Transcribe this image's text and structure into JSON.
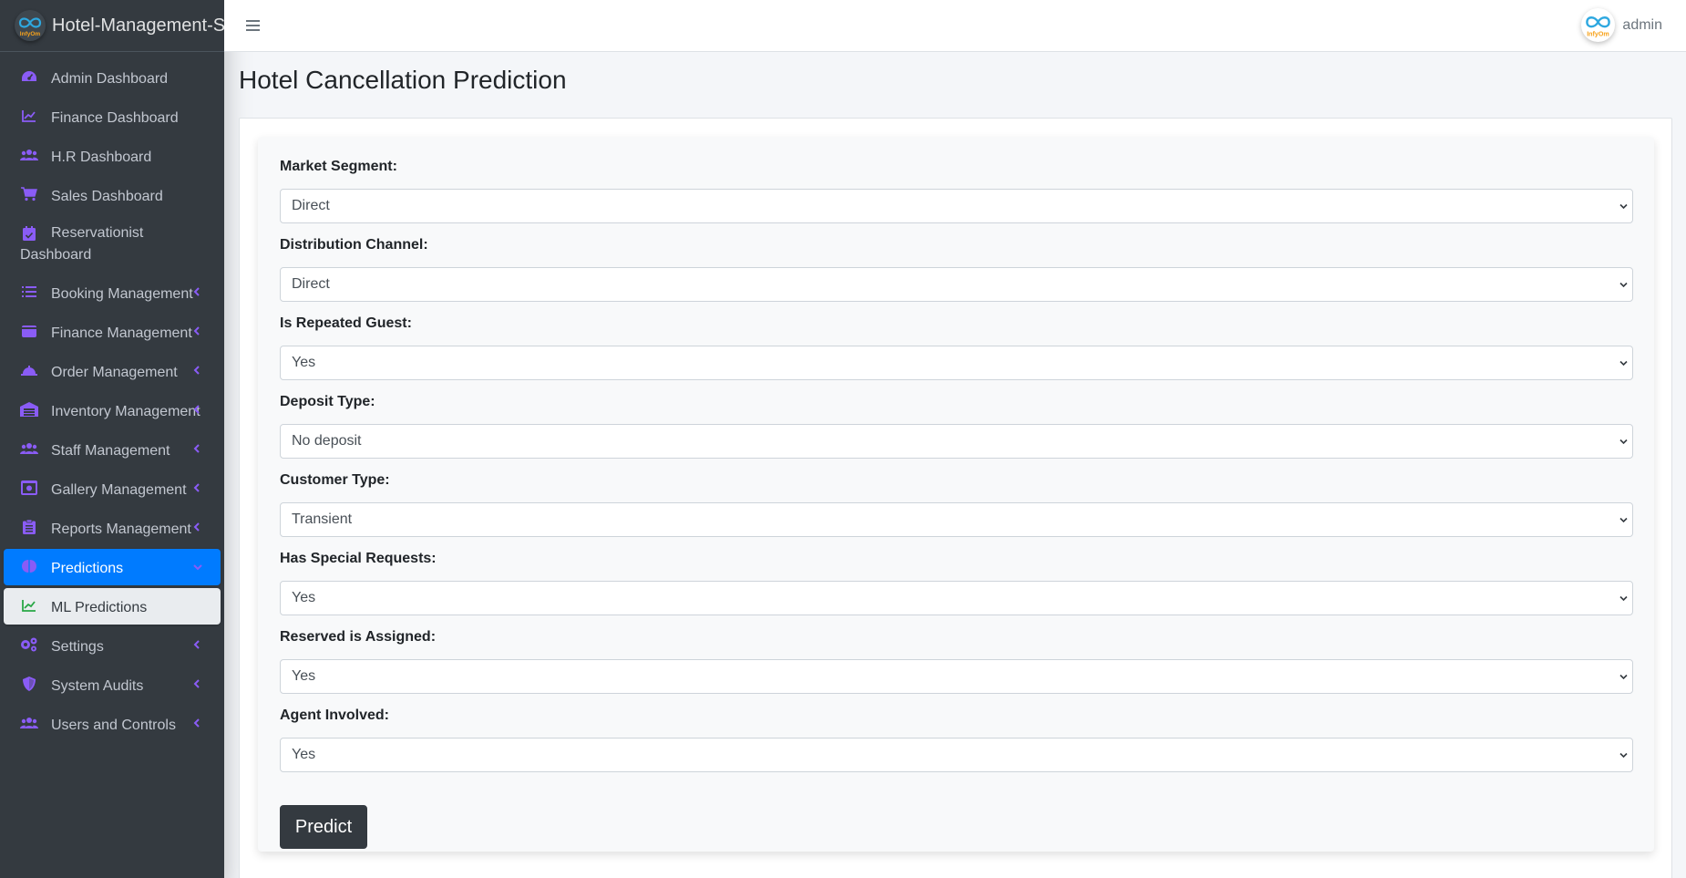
{
  "brand": {
    "title": "Hotel-Management-S",
    "logo_text": "InfyOm"
  },
  "colors": {
    "sidebar_bg": "#343a40",
    "icon_purple": "#8a5cf6",
    "active_bg": "#007bff",
    "predict_btn": "#343a40",
    "ml_icon": "#28a745"
  },
  "sidebar": {
    "items": [
      {
        "label": "Admin Dashboard",
        "icon": "gauge-icon"
      },
      {
        "label": "Finance Dashboard",
        "icon": "line-chart-icon"
      },
      {
        "label": "H.R Dashboard",
        "icon": "users-icon"
      },
      {
        "label": "Sales Dashboard",
        "icon": "cart-icon"
      },
      {
        "label": "Reservationist Dashboard",
        "icon": "calendar-check-icon"
      },
      {
        "label": "Booking Management",
        "icon": "list-icon"
      },
      {
        "label": "Finance Management",
        "icon": "wallet-icon"
      },
      {
        "label": "Order Management",
        "icon": "bell-concierge-icon"
      },
      {
        "label": "Inventory Management",
        "icon": "warehouse-icon"
      },
      {
        "label": "Staff Management",
        "icon": "users-icon"
      },
      {
        "label": "Gallery Management",
        "icon": "image-icon"
      },
      {
        "label": "Reports Management",
        "icon": "clipboard-icon"
      },
      {
        "label": "Predictions",
        "icon": "brain-icon"
      },
      {
        "label": "ML Predictions",
        "icon": "line-chart-icon"
      },
      {
        "label": "Settings",
        "icon": "gears-icon"
      },
      {
        "label": "System Audits",
        "icon": "shield-icon"
      },
      {
        "label": "Users and Controls",
        "icon": "users-icon"
      }
    ]
  },
  "header": {
    "user_name": "admin"
  },
  "page": {
    "title": "Hotel Cancellation Prediction"
  },
  "form": {
    "fields": [
      {
        "label": "Market Segment:",
        "value": "Direct"
      },
      {
        "label": "Distribution Channel:",
        "value": "Direct"
      },
      {
        "label": "Is Repeated Guest:",
        "value": "Yes"
      },
      {
        "label": "Deposit Type:",
        "value": "No deposit"
      },
      {
        "label": "Customer Type:",
        "value": "Transient"
      },
      {
        "label": "Has Special Requests:",
        "value": "Yes"
      },
      {
        "label": "Reserved is Assigned:",
        "value": "Yes"
      },
      {
        "label": "Agent Involved:",
        "value": "Yes"
      }
    ],
    "submit_label": "Predict"
  }
}
